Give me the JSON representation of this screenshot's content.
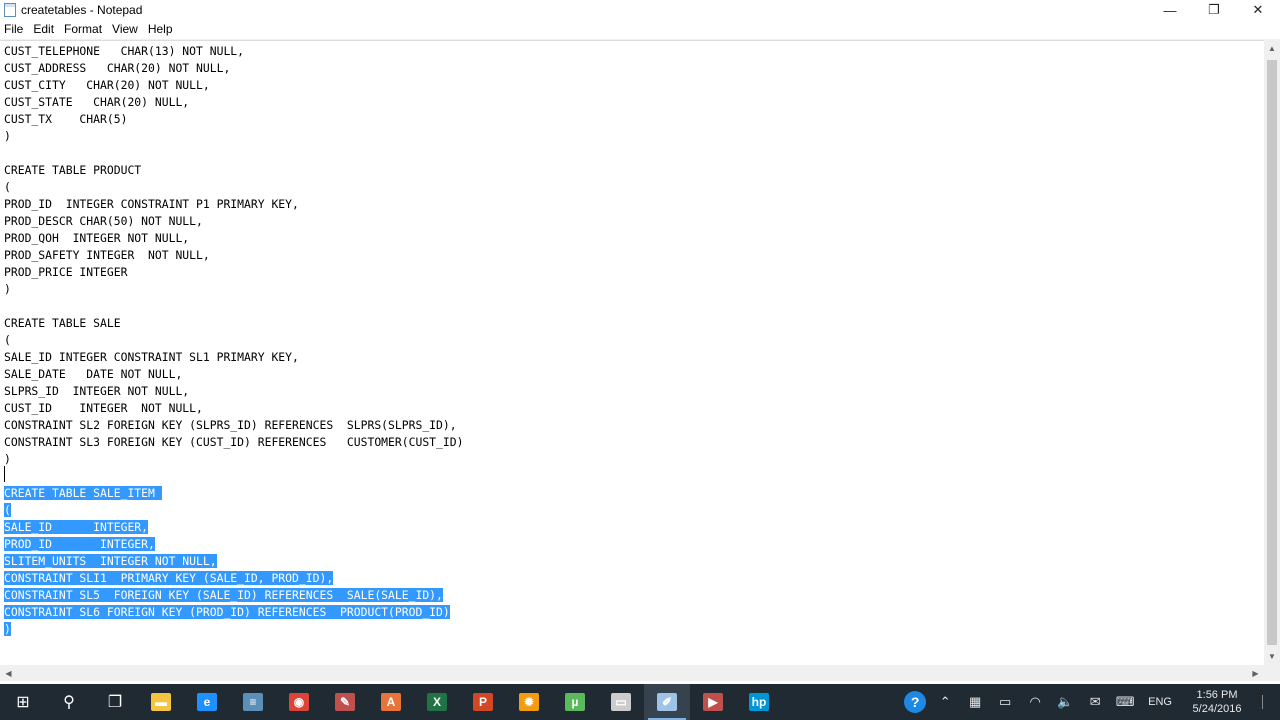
{
  "window": {
    "title": "createtables - Notepad",
    "controls": {
      "minimize": "—",
      "maximize": "❐",
      "close": "✕"
    }
  },
  "menu": [
    "File",
    "Edit",
    "Format",
    "View",
    "Help"
  ],
  "editor": {
    "lines": [
      {
        "text": "CUST_TELEPHONE   CHAR(13) NOT NULL,",
        "selected": false
      },
      {
        "text": "CUST_ADDRESS   CHAR(20) NOT NULL,",
        "selected": false
      },
      {
        "text": "CUST_CITY   CHAR(20) NOT NULL,",
        "selected": false
      },
      {
        "text": "CUST_STATE   CHAR(20) NULL,",
        "selected": false
      },
      {
        "text": "CUST_TX    CHAR(5)",
        "selected": false
      },
      {
        "text": ")",
        "selected": false
      },
      {
        "text": "",
        "selected": false
      },
      {
        "text": "CREATE TABLE PRODUCT",
        "selected": false
      },
      {
        "text": "(",
        "selected": false
      },
      {
        "text": "PROD_ID  INTEGER CONSTRAINT P1 PRIMARY KEY,",
        "selected": false
      },
      {
        "text": "PROD_DESCR CHAR(50) NOT NULL,",
        "selected": false
      },
      {
        "text": "PROD_QOH  INTEGER NOT NULL,",
        "selected": false
      },
      {
        "text": "PROD_SAFETY INTEGER  NOT NULL,",
        "selected": false
      },
      {
        "text": "PROD_PRICE INTEGER",
        "selected": false
      },
      {
        "text": ")",
        "selected": false
      },
      {
        "text": "",
        "selected": false
      },
      {
        "text": "CREATE TABLE SALE",
        "selected": false
      },
      {
        "text": "(",
        "selected": false
      },
      {
        "text": "SALE_ID INTEGER CONSTRAINT SL1 PRIMARY KEY,",
        "selected": false
      },
      {
        "text": "SALE_DATE   DATE NOT NULL,",
        "selected": false
      },
      {
        "text": "SLPRS_ID  INTEGER NOT NULL,",
        "selected": false
      },
      {
        "text": "CUST_ID    INTEGER  NOT NULL,",
        "selected": false
      },
      {
        "text": "CONSTRAINT SL2 FOREIGN KEY (SLPRS_ID) REFERENCES  SLPRS(SLPRS_ID),",
        "selected": false
      },
      {
        "text": "CONSTRAINT SL3 FOREIGN KEY (CUST_ID) REFERENCES   CUSTOMER(CUST_ID)",
        "selected": false
      },
      {
        "text": ")",
        "selected": false
      },
      {
        "text": "",
        "selected": false
      },
      {
        "text": "CREATE TABLE SALE_ITEM ",
        "selected": true
      },
      {
        "text": "(",
        "selected": true
      },
      {
        "text": "SALE_ID      INTEGER,",
        "selected": true
      },
      {
        "text": "PROD_ID       INTEGER,",
        "selected": true
      },
      {
        "text": "SLITEM_UNITS  INTEGER NOT NULL,",
        "selected": true
      },
      {
        "text": "CONSTRAINT SLI1  PRIMARY KEY (SALE_ID, PROD_ID),",
        "selected": true
      },
      {
        "text": "CONSTRAINT SL5  FOREIGN KEY (SALE_ID) REFERENCES  SALE(SALE_ID),",
        "selected": true
      },
      {
        "text": "CONSTRAINT SL6 FOREIGN KEY (PROD_ID) REFERENCES  PRODUCT(PROD_ID)",
        "selected": true
      },
      {
        "text": ")",
        "selected": true
      }
    ]
  },
  "taskbar": {
    "apps": [
      {
        "name": "start-button",
        "icon": "windows-logo",
        "color": "#ffffff",
        "glyph": "⊞"
      },
      {
        "name": "search-button",
        "icon": "search-icon",
        "color": "#ffffff",
        "glyph": "⚲"
      },
      {
        "name": "task-view-button",
        "icon": "task-view-icon",
        "color": "#ffffff",
        "glyph": "❐"
      },
      {
        "name": "file-explorer",
        "icon": "folder-icon",
        "color": "#f4c542",
        "glyph": "▬"
      },
      {
        "name": "edge-browser",
        "icon": "edge-icon",
        "color": "#1e90ff",
        "glyph": "e"
      },
      {
        "name": "notepad-app",
        "icon": "notepad-icon",
        "color": "#5b8fb9",
        "glyph": "≡"
      },
      {
        "name": "chrome-browser",
        "icon": "chrome-icon",
        "color": "#db4437",
        "glyph": "◉"
      },
      {
        "name": "sql-tool",
        "icon": "pen-icon",
        "color": "#c0504d",
        "glyph": "✎"
      },
      {
        "name": "access-app",
        "icon": "database-icon",
        "color": "#e8743b",
        "glyph": "A"
      },
      {
        "name": "excel-app",
        "icon": "excel-icon",
        "color": "#217346",
        "glyph": "X"
      },
      {
        "name": "powerpoint-app",
        "icon": "powerpoint-icon",
        "color": "#d24726",
        "glyph": "P"
      },
      {
        "name": "settings-app",
        "icon": "gear-icon",
        "color": "#f39c12",
        "glyph": "✹"
      },
      {
        "name": "utorrent-app",
        "icon": "utorrent-icon",
        "color": "#5cb85c",
        "glyph": "µ"
      },
      {
        "name": "screen-app",
        "icon": "monitor-icon",
        "color": "#cccccc",
        "glyph": "▭"
      },
      {
        "name": "notepad-active",
        "icon": "notepad-icon",
        "color": "#9ec3e6",
        "glyph": "✐"
      },
      {
        "name": "media-app",
        "icon": "media-icon",
        "color": "#c0504d",
        "glyph": "▶"
      },
      {
        "name": "hp-app",
        "icon": "hp-icon",
        "color": "#0096d6",
        "glyph": "hp"
      }
    ],
    "tray": [
      {
        "name": "help-icon",
        "glyph": "?"
      },
      {
        "name": "chevron-up-icon",
        "glyph": "⌃"
      },
      {
        "name": "network-device-icon",
        "glyph": "▦"
      },
      {
        "name": "battery-icon",
        "glyph": "▭"
      },
      {
        "name": "wifi-icon",
        "glyph": "◠"
      },
      {
        "name": "volume-icon",
        "glyph": "🔈"
      },
      {
        "name": "message-icon",
        "glyph": "✉"
      },
      {
        "name": "keyboard-icon",
        "glyph": "⌨"
      }
    ],
    "language": "ENG",
    "time": "1:56 PM",
    "date": "5/24/2016"
  }
}
